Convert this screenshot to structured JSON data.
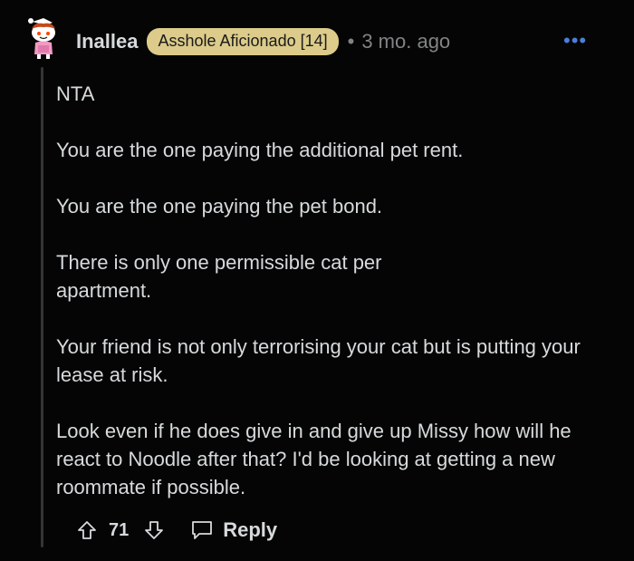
{
  "comment": {
    "username": "Inallea",
    "flair": "Asshole Aficionado [14]",
    "separator": "•",
    "time": "3 mo. ago",
    "more_label": "•••",
    "body": [
      "NTA",
      "You are the one paying the additional pet rent.",
      "You are the one paying the pet bond.",
      "There is only one permissible cat per apartment.",
      "Your friend is not only terrorising your cat but is putting your lease at risk.",
      "Look even if he does give in and give up Missy how will he react to Noodle after that? I'd be looking at getting a new roommate if possible."
    ],
    "score": "71",
    "reply_label": "Reply"
  },
  "icons": {
    "avatar": "snoo-avatar-icon",
    "upvote": "upvote-arrow-icon",
    "downvote": "downvote-arrow-icon",
    "reply": "speech-bubble-icon",
    "more": "more-dots-icon"
  },
  "colors": {
    "background": "#050505",
    "text": "#d7dadc",
    "muted": "#818384",
    "flair_bg": "#dccb8a",
    "flair_text": "#1a1a1b",
    "more_icon": "#4a7fd9",
    "thread_line": "#343536"
  }
}
